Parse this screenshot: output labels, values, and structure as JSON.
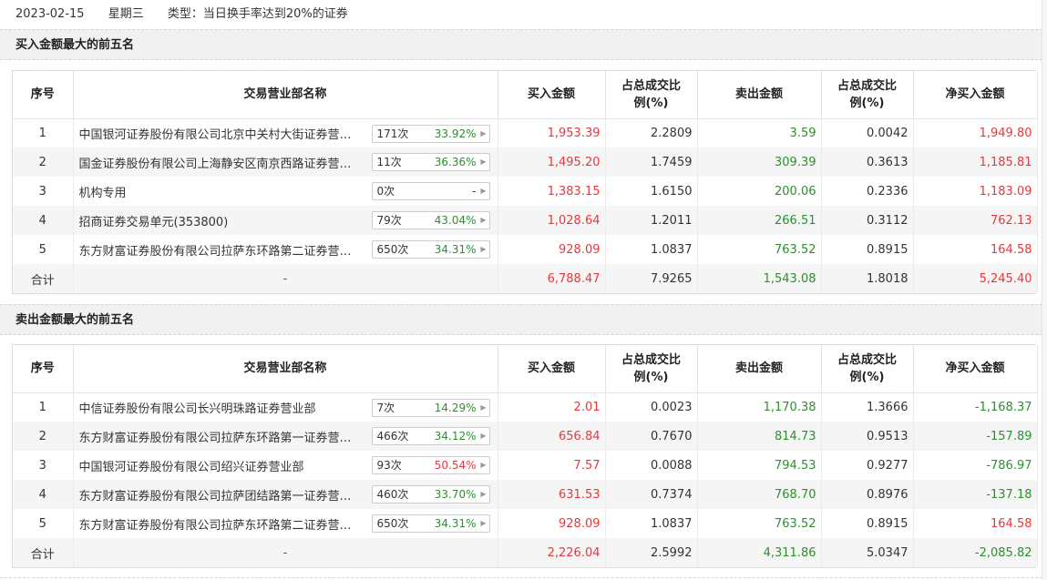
{
  "header": {
    "date": "2023-02-15",
    "weekday": "星期三",
    "type_label": "类型：当日换手率达到20%的证券"
  },
  "columns": {
    "idx": "序号",
    "name": "交易营业部名称",
    "buy": "买入金额",
    "buy_ratio_1": "占总成交比",
    "buy_ratio_2": "例(%)",
    "sell": "卖出金额",
    "sell_ratio_1": "占总成交比",
    "sell_ratio_2": "例(%)",
    "net": "净买入金额"
  },
  "buy_top5": {
    "title": "买入金额最大的前五名",
    "rows": [
      {
        "idx": "1",
        "name": "中国银河证券股份有限公司北京中关村大街证券营业部",
        "count": "171次",
        "pct": "33.92%",
        "buy": "1,953.39",
        "buy_ratio": "2.2809",
        "sell": "3.59",
        "sell_ratio": "0.0042",
        "net": "1,949.80"
      },
      {
        "idx": "2",
        "name": "国金证券股份有限公司上海静安区南京西路证券营业部",
        "count": "11次",
        "pct": "36.36%",
        "buy": "1,495.20",
        "buy_ratio": "1.7459",
        "sell": "309.39",
        "sell_ratio": "0.3613",
        "net": "1,185.81"
      },
      {
        "idx": "3",
        "name": "机构专用",
        "count": "0次",
        "pct": "-",
        "buy": "1,383.15",
        "buy_ratio": "1.6150",
        "sell": "200.06",
        "sell_ratio": "0.2336",
        "net": "1,183.09"
      },
      {
        "idx": "4",
        "name": "招商证券交易单元(353800)",
        "count": "79次",
        "pct": "43.04%",
        "buy": "1,028.64",
        "buy_ratio": "1.2011",
        "sell": "266.51",
        "sell_ratio": "0.3112",
        "net": "762.13"
      },
      {
        "idx": "5",
        "name": "东方财富证券股份有限公司拉萨东环路第二证券营业部",
        "count": "650次",
        "pct": "34.31%",
        "buy": "928.09",
        "buy_ratio": "1.0837",
        "sell": "763.52",
        "sell_ratio": "0.8915",
        "net": "164.58"
      }
    ],
    "total": {
      "label": "合计",
      "name": "-",
      "buy": "6,788.47",
      "buy_ratio": "7.9265",
      "sell": "1,543.08",
      "sell_ratio": "1.8018",
      "net": "5,245.40"
    }
  },
  "sell_top5": {
    "title": "卖出金额最大的前五名",
    "rows": [
      {
        "idx": "1",
        "name": "中信证券股份有限公司长兴明珠路证券营业部",
        "count": "7次",
        "pct": "14.29%",
        "buy": "2.01",
        "buy_ratio": "0.0023",
        "sell": "1,170.38",
        "sell_ratio": "1.3666",
        "net": "-1,168.37"
      },
      {
        "idx": "2",
        "name": "东方财富证券股份有限公司拉萨东环路第一证券营业部",
        "count": "466次",
        "pct": "34.12%",
        "buy": "656.84",
        "buy_ratio": "0.7670",
        "sell": "814.73",
        "sell_ratio": "0.9513",
        "net": "-157.89"
      },
      {
        "idx": "3",
        "name": "中国银河证券股份有限公司绍兴证券营业部",
        "count": "93次",
        "pct": "50.54%",
        "buy": "7.57",
        "buy_ratio": "0.0088",
        "sell": "794.53",
        "sell_ratio": "0.9277",
        "net": "-786.97"
      },
      {
        "idx": "4",
        "name": "东方财富证券股份有限公司拉萨团结路第一证券营业部",
        "count": "460次",
        "pct": "33.70%",
        "buy": "631.53",
        "buy_ratio": "0.7374",
        "sell": "768.70",
        "sell_ratio": "0.8976",
        "net": "-137.18"
      },
      {
        "idx": "5",
        "name": "东方财富证券股份有限公司拉萨东环路第二证券营业部",
        "count": "650次",
        "pct": "34.31%",
        "buy": "928.09",
        "buy_ratio": "1.0837",
        "sell": "763.52",
        "sell_ratio": "0.8915",
        "net": "164.58"
      }
    ],
    "total": {
      "label": "合计",
      "name": "-",
      "buy": "2,226.04",
      "buy_ratio": "2.5992",
      "sell": "4,311.86",
      "sell_ratio": "5.0347",
      "net": "-2,085.82"
    }
  },
  "colors": {
    "up": "#e4393c",
    "down": "#2d8f2d"
  }
}
